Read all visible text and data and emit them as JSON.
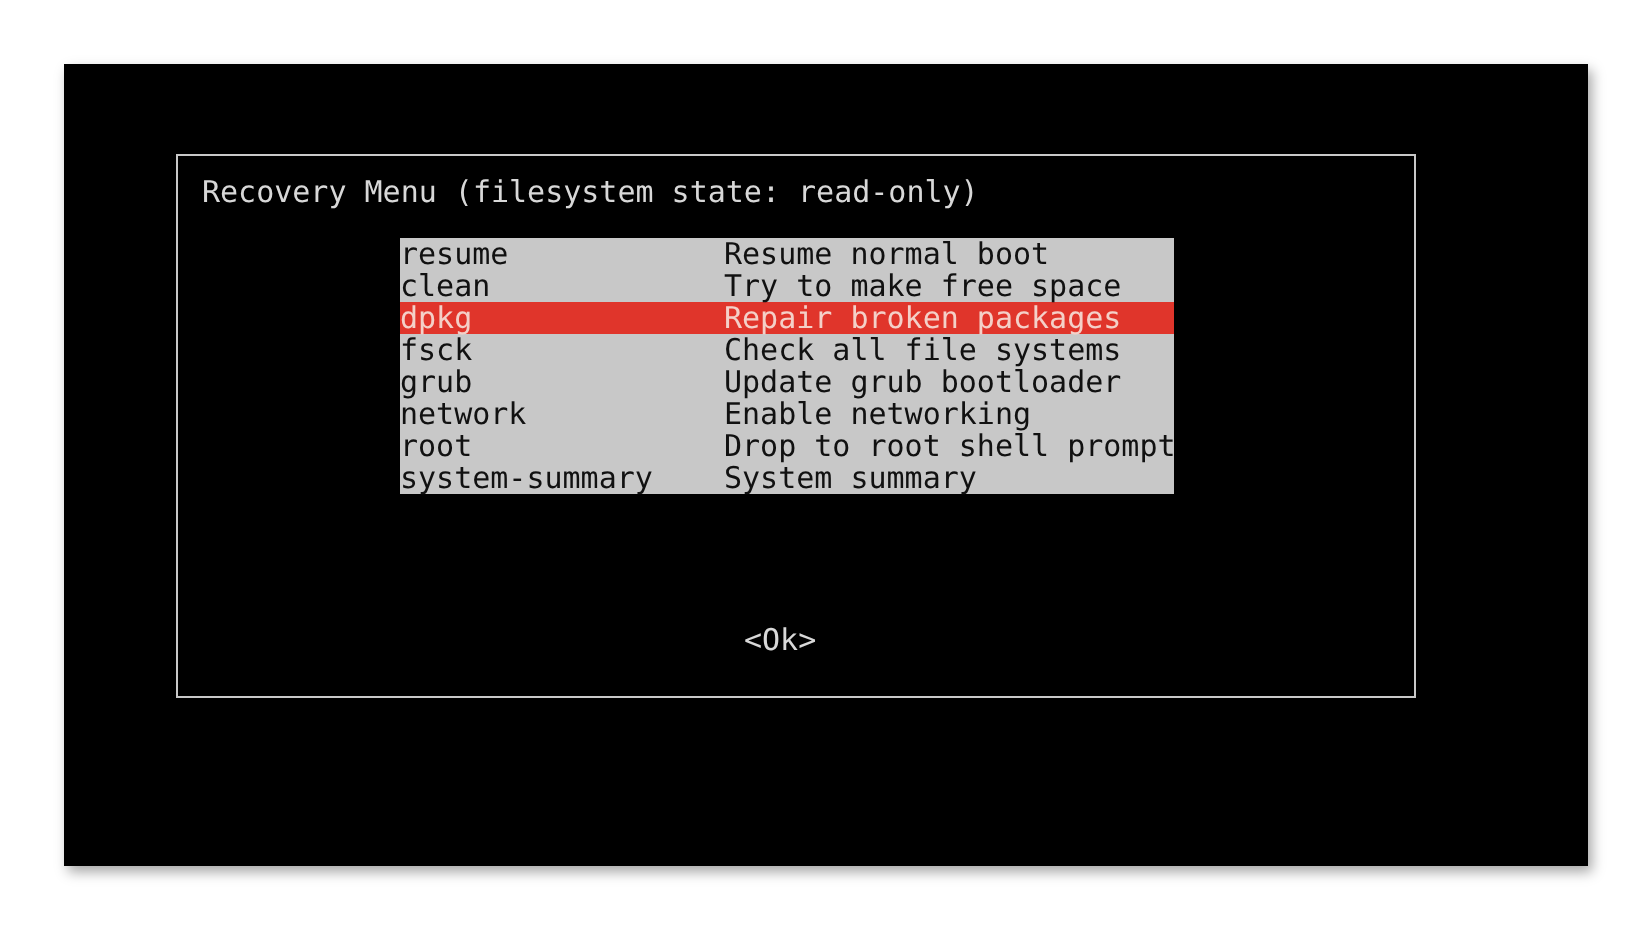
{
  "dialog": {
    "title": "Recovery Menu (filesystem state: read-only)",
    "menu": [
      {
        "command": "resume",
        "description": "Resume normal boot",
        "selected": false
      },
      {
        "command": "clean",
        "description": "Try to make free space",
        "selected": false
      },
      {
        "command": "dpkg",
        "description": "Repair broken packages",
        "selected": true
      },
      {
        "command": "fsck",
        "description": "Check all file systems",
        "selected": false
      },
      {
        "command": "grub",
        "description": "Update grub bootloader",
        "selected": false
      },
      {
        "command": "network",
        "description": "Enable networking",
        "selected": false
      },
      {
        "command": "root",
        "description": "Drop to root shell prompt",
        "selected": false
      },
      {
        "command": "system-summary",
        "description": "System summary",
        "selected": false
      }
    ],
    "button": "<Ok>"
  }
}
